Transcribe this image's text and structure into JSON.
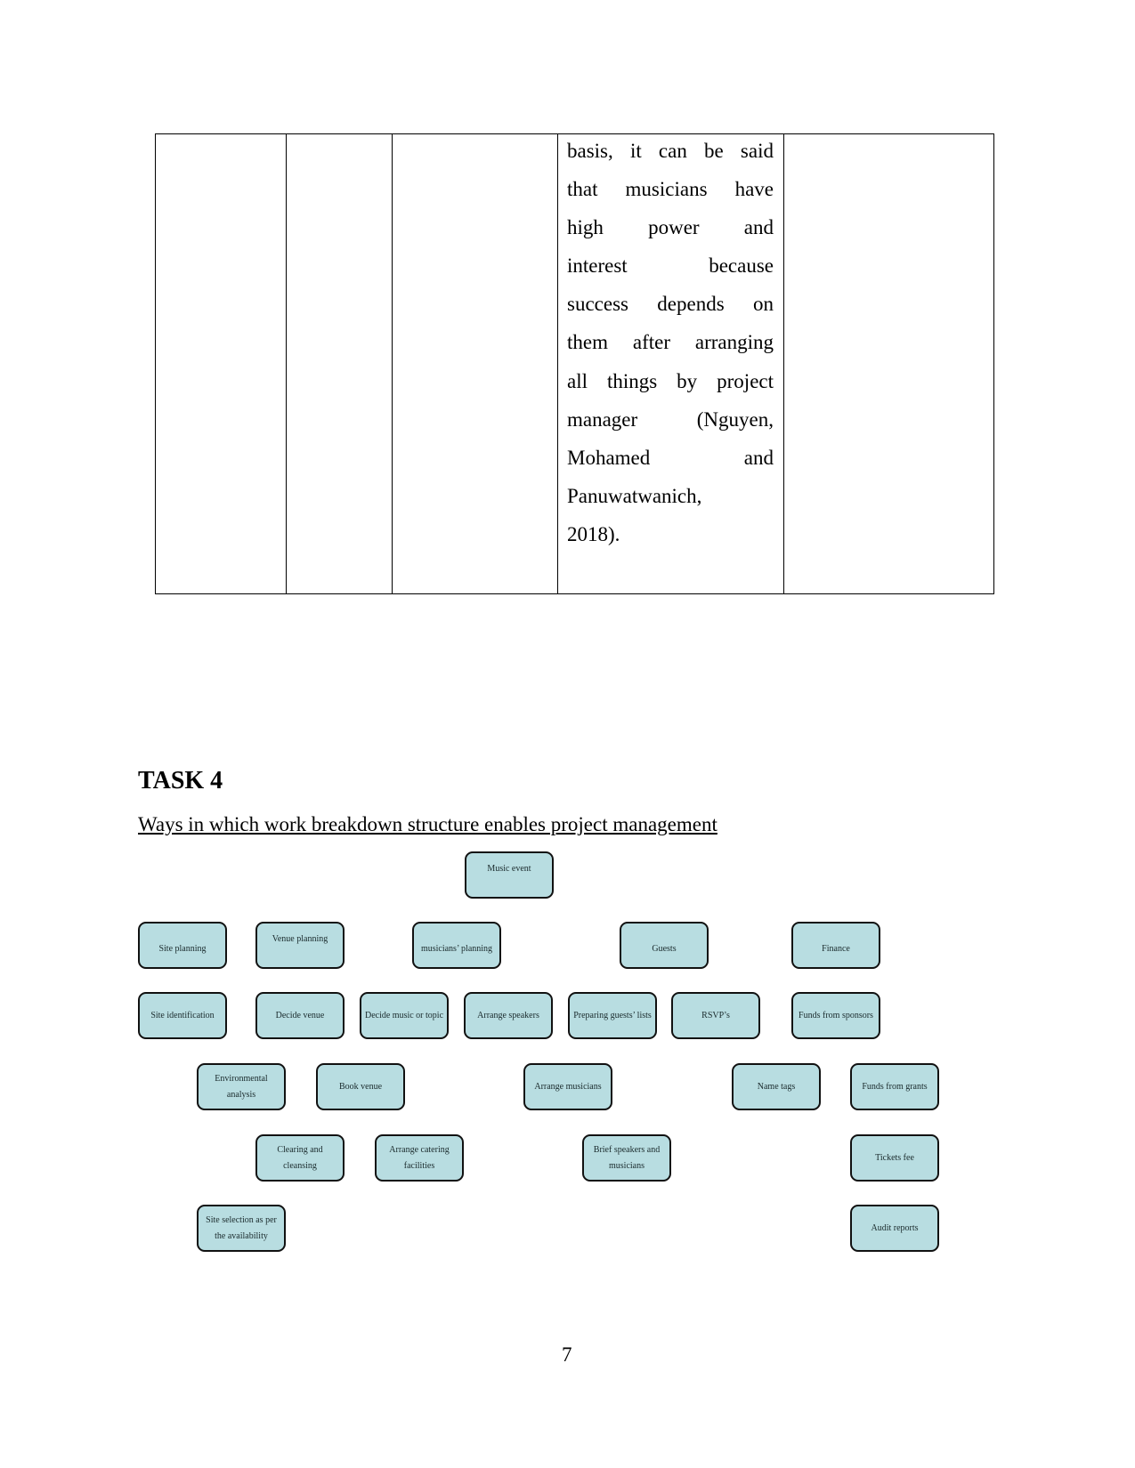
{
  "table": {
    "cell_text_lines": [
      "basis, it can be said",
      "that musicians have",
      "high power and",
      "interest because",
      "success depends on",
      "them after arranging",
      "all things by project",
      "manager (Nguyen,",
      "Mohamed and",
      "Panuwatwanich,",
      "2018)."
    ]
  },
  "task": {
    "heading": "TASK 4",
    "subtitle": "Ways in which work breakdown structure enables project management"
  },
  "wbs": {
    "root": "Music event",
    "level1": [
      "Site planning",
      "Venue planning",
      "musicians’ planning",
      "Guests",
      "Finance"
    ],
    "row2": [
      "Site identification",
      "Decide venue",
      "Decide music or topic",
      "Arrange speakers",
      "Preparing guests’ lists",
      "RSVP’s",
      "Funds from sponsors"
    ],
    "row3": [
      "Environmental analysis",
      "Book venue",
      "Arrange musicians",
      "Name tags",
      "Funds from grants"
    ],
    "row4": [
      "Clearing and cleansing",
      "Arrange catering facilities",
      "Brief speakers and musicians",
      "Tickets fee"
    ],
    "row5": [
      "Site selection as per the availability",
      "Audit reports"
    ],
    "box_fill": "#b8dde1"
  },
  "page_number": "7"
}
